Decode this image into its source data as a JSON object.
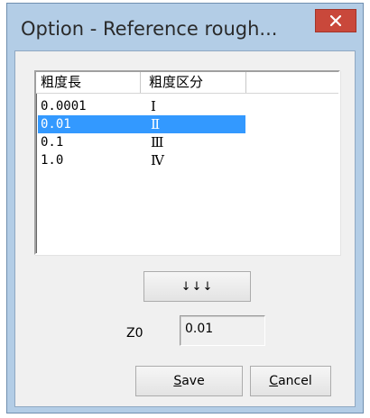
{
  "window": {
    "title": "Option - Reference rough...",
    "close_icon": "close-icon"
  },
  "list": {
    "columns": [
      "粗度長",
      "粗度区分",
      ""
    ],
    "rows": [
      {
        "value": "0.0001",
        "rank": "Ⅰ",
        "selected": false
      },
      {
        "value": "0.01",
        "rank": "Ⅱ",
        "selected": true
      },
      {
        "value": "0.1",
        "rank": "Ⅲ",
        "selected": false
      },
      {
        "value": "1.0",
        "rank": "Ⅳ",
        "selected": false
      }
    ]
  },
  "copy_button": {
    "label": "↓↓↓"
  },
  "z0": {
    "label": "Z0",
    "value": "0.01"
  },
  "buttons": {
    "save_mnemonic": "S",
    "save_rest": "ave",
    "cancel_mnemonic": "C",
    "cancel_rest": "ancel"
  },
  "colors": {
    "selection": "#3399ff",
    "title_bar": "#b3cde6",
    "close_button": "#c9483b"
  }
}
